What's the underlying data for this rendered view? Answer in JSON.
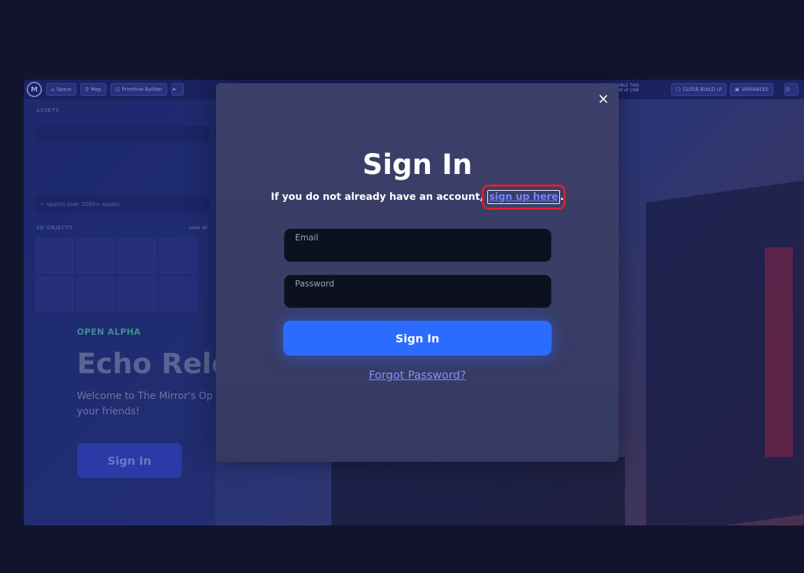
{
  "background_app": {
    "topbar": {
      "buttons": [
        "Space",
        "Map",
        "Primitive Builder"
      ],
      "visibility_label": "VISIBLE THIS",
      "visibility_value": "6.7M of 10M",
      "close_build_label": "CLOSE BUILD UI",
      "variables_label": "VARIABLES"
    },
    "sidebar": {
      "assets_label": "ASSETS",
      "search_placeholder": "search over 2000+ assets",
      "objects_label": "3D OBJECTS",
      "view_all": "view all"
    },
    "hero": {
      "tag": "OPEN ALPHA",
      "title": "Echo Rele",
      "description": "Welcome to The Mirror's Op your friends!",
      "button": "Sign In"
    }
  },
  "modal": {
    "close_icon": "×",
    "title": "Sign In",
    "subtitle_prefix": "If you do not already have an account, ",
    "signup_link": "sign up here",
    "subtitle_suffix": ".",
    "email_label": "Email",
    "email_value": "",
    "password_label": "Password",
    "password_value": "",
    "submit_label": "Sign In",
    "forgot_label": "Forgot Password?"
  },
  "colors": {
    "page_bg": "#12142e",
    "modal_bg": "#3a3e66",
    "accent": "#2b6bff",
    "link": "#6f86ff",
    "highlight": "#e01e2a"
  }
}
